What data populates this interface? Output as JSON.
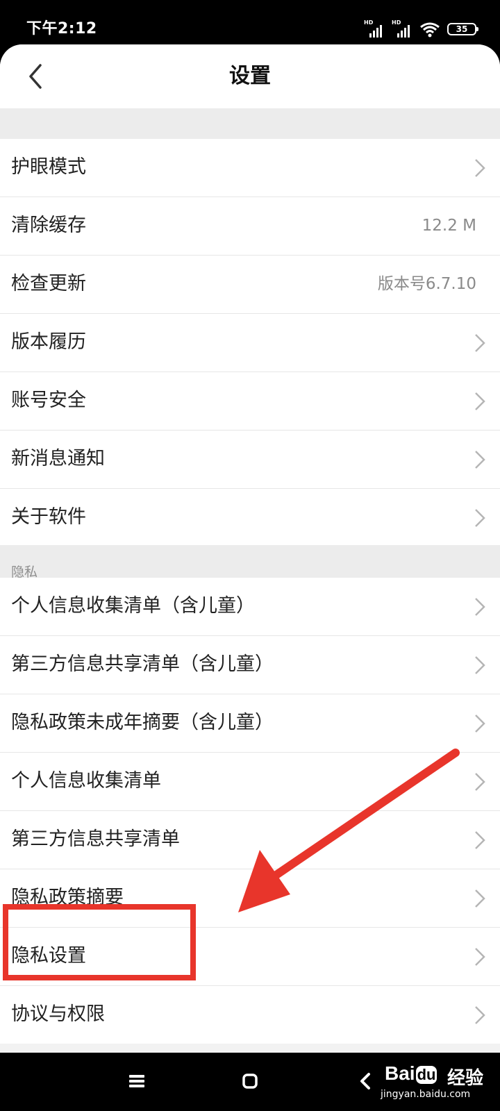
{
  "status_bar": {
    "time": "下午2:12",
    "battery": "35",
    "hd1": "HD",
    "hd2": "HD"
  },
  "header": {
    "title": "设置"
  },
  "general_items": [
    {
      "label": "护眼模式",
      "value": ""
    },
    {
      "label": "清除缓存",
      "value": "12.2 M"
    },
    {
      "label": "检查更新",
      "value": "版本号6.7.10"
    },
    {
      "label": "版本履历",
      "value": ""
    },
    {
      "label": "账号安全",
      "value": ""
    },
    {
      "label": "新消息通知",
      "value": ""
    },
    {
      "label": "关于软件",
      "value": ""
    }
  ],
  "privacy_section": {
    "label": "隐私",
    "items": [
      {
        "label": "个人信息收集清单（含儿童）"
      },
      {
        "label": "第三方信息共享清单（含儿童）"
      },
      {
        "label": "隐私政策未成年摘要（含儿童）"
      },
      {
        "label": "个人信息收集清单"
      },
      {
        "label": "第三方信息共享清单"
      },
      {
        "label": "隐私政策摘要"
      },
      {
        "label": "隐私设置"
      },
      {
        "label": "协议与权限"
      }
    ]
  },
  "watermark": {
    "brand_a": "Bai",
    "brand_b": "du",
    "brand_c": "经验",
    "url": "jingyan.baidu.com"
  },
  "colors": {
    "highlight": "#e8352b",
    "background": "#f2f2f2"
  },
  "icons": [
    "back-arrow-icon",
    "chevron-right-icon",
    "signal-icon",
    "wifi-icon",
    "battery-icon",
    "menu-icon",
    "home-icon",
    "nav-back-icon"
  ]
}
